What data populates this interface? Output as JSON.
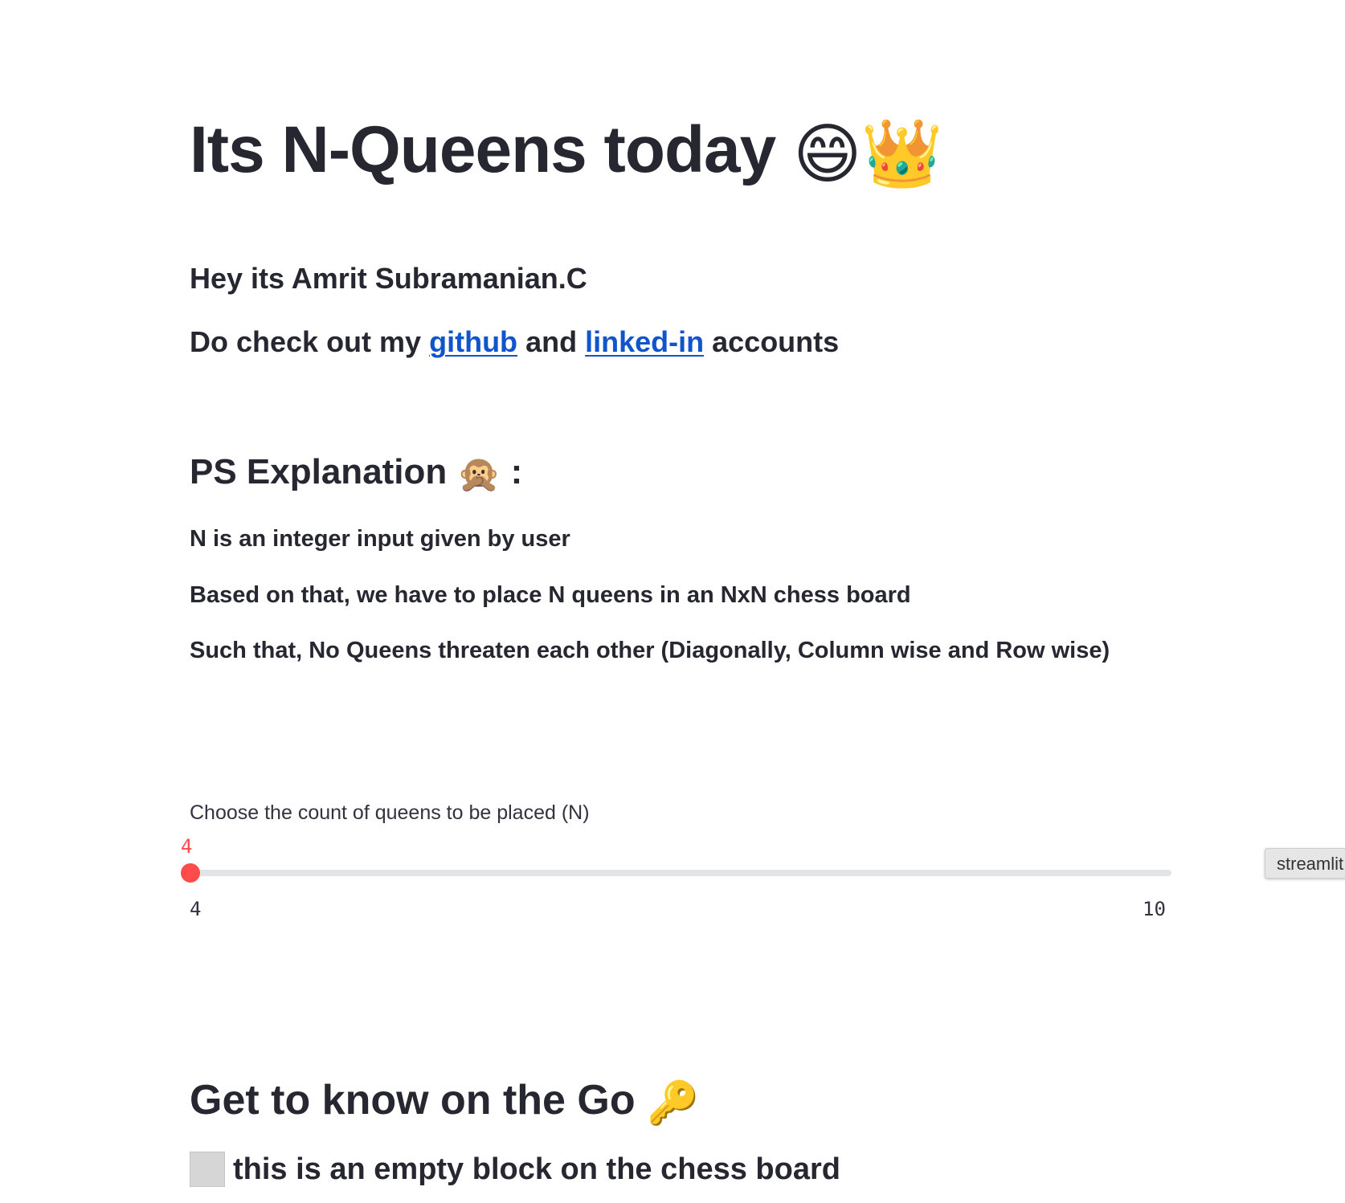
{
  "title": {
    "text": "Its N-Queens today",
    "emojis": [
      "😄",
      "👑"
    ]
  },
  "intro": {
    "line1": "Hey its Amrit Subramanian.C",
    "line2_prefix": "Do check out my",
    "github_label": "github",
    "line2_mid": "and",
    "linkedin_label": "linked-in",
    "line2_suffix": "accounts"
  },
  "ps": {
    "heading": "PS Explanation",
    "heading_emoji": "🙊",
    "heading_suffix": ":",
    "lines": [
      "N is an integer input given by user",
      "Based on that, we have to place N queens in an NxN chess board",
      "Such that, No Queens threaten each other (Diagonally, Column wise and Row wise)"
    ]
  },
  "slider": {
    "label": "Choose the count of queens to be placed (N)",
    "value": "4",
    "min": "4",
    "max": "10",
    "accent_color": "#ff4b4b",
    "track_color": "#e3e4e8"
  },
  "tooltip": {
    "text": "streamlit"
  },
  "legend_section": {
    "heading": "Get to know on the Go",
    "heading_emoji": "🔑",
    "empty_block_text": "this is an empty block on the chess board",
    "empty_block_color": "#d6d6d6"
  },
  "colors": {
    "text": "#262730",
    "link": "#1155cc",
    "background": "#ffffff"
  }
}
